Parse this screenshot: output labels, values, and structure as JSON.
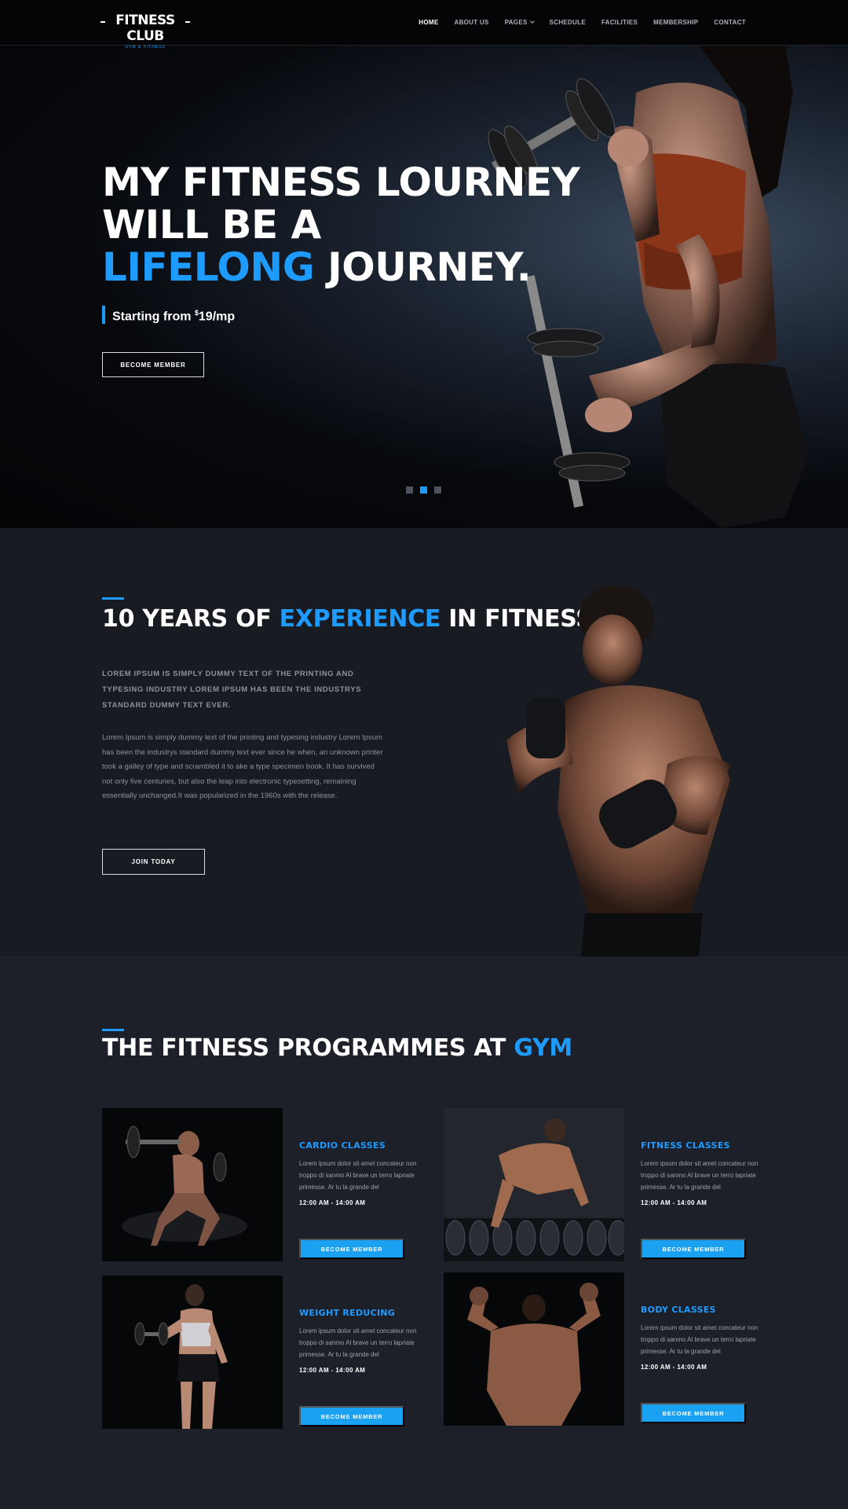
{
  "brand": {
    "logo_text": "FITNESS CLUB",
    "logo_sub": "GYM & FITNESS"
  },
  "nav": {
    "items": [
      {
        "label": "HOME",
        "active": true
      },
      {
        "label": "ABOUT US"
      },
      {
        "label": "PAGES"
      },
      {
        "label": "SCHEDULE"
      },
      {
        "label": "FACILITIES"
      },
      {
        "label": "MEMBERSHIP"
      },
      {
        "label": "CONTACT"
      }
    ]
  },
  "hero": {
    "line1": "MY FITNESS LOURNEY",
    "line2": "WILL BE A",
    "line3_highlight": "LIFELONG",
    "line3_rest": " JOURNEY.",
    "sub_prefix": "Starting from ",
    "sub_currency": "$",
    "sub_amount": "19/mp",
    "button": "BECOME MEMBER",
    "slides": 3,
    "active_slide": 2
  },
  "experience": {
    "title_pre": "10 YEARS OF ",
    "title_highlight": "EXPERIENCE",
    "title_post": " IN FITNESS",
    "lead": "LOREM IPSUM IS SIMPLY DUMMY TEXT OF THE PRINTING AND TYPESING INDUSTRY LOREM IPSUM HAS BEEN THE INDUSTRYS STANDARD DUMMY TEXT EVER.",
    "body": "Lorem Ipsum is simply dummy text of the printing and typesing industry Lorem Ipsum has been the industrys standard dummy text ever since he when, an unknown printer took a galley of type and scrambled it to ake a type specimen book. It has survived not only five centuries, but also the leap into electronic typesetting, remaining essentially unchanged.It was popularized in the 1960s with the release.",
    "button": "JOIN TODAY"
  },
  "programmes": {
    "title_pre": "THE FITNESS PROGRAMMES AT ",
    "title_highlight": "GYM",
    "cards": [
      {
        "title": "CARDIO CLASSES",
        "text": "Lorem ipsum dolor sit amet concateur non troppo di sanmo Al brave un terro lapriate primesse. Ar tu la grande del",
        "time": "12:00 AM - 14:00 AM",
        "button": "BECOME MEMBER"
      },
      {
        "title": "FITNESS CLASSES",
        "text": "Lorem ipsum dolor sit amet concateur non troppo di sanmo Al brave un terro lapriate primesse. Ar tu la grande del",
        "time": "12:00 AM - 14:00 AM",
        "button": "BECOME MEMBER"
      },
      {
        "title": "WEIGHT REDUCING",
        "text": "Lorem ipsum dolor sit amet concateur non troppo di sanmo Al brave un terro lapriate primesse. Ar tu la grande del",
        "time": "12:00 AM - 14:00 AM",
        "button": "BECOME MEMBER"
      },
      {
        "title": "BODY CLASSES",
        "text": "Lorem ipsum dolor sit amet concateur non troppo di sanmo Al brave un terro lapriate primesse. Ar tu la grande del",
        "time": "12:00 AM - 14:00 AM",
        "button": "BECOME MEMBER"
      }
    ]
  },
  "colors": {
    "accent": "#1e9bff",
    "button_blue": "#1ba1f2",
    "background": "#1a1c23"
  }
}
